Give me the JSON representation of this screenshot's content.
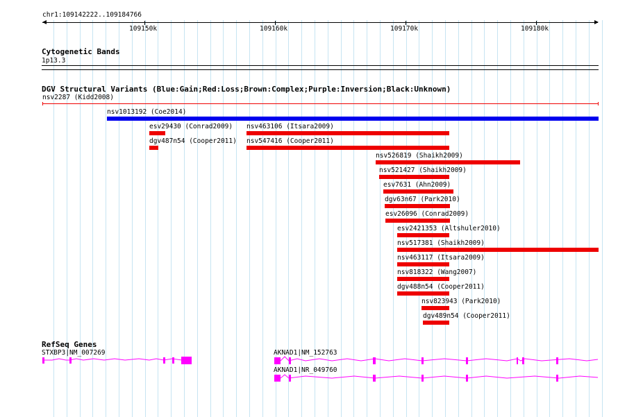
{
  "ruler": {
    "coordinates": "chr1:109142222..109184766",
    "ticks": [
      "109150k",
      "109160k",
      "109170k",
      "109180k"
    ]
  },
  "cytoband": {
    "title": "Cytogenetic Bands",
    "band": "1p13.3"
  },
  "dgv": {
    "title": "DGV Structural Variants (Blue:Gain;Red:Loss;Brown:Complex;Purple:Inversion;Black:Unknown)",
    "colors": {
      "gain": "#0000ee",
      "loss": "#ee0000"
    },
    "variants": [
      {
        "label": "nsv2287 (Kidd2008)",
        "type": "loss"
      },
      {
        "label": "nsv1013192 (Coe2014)",
        "type": "gain"
      },
      {
        "label": "esv29430 (Conrad2009)",
        "type": "loss"
      },
      {
        "label": "nsv463106 (Itsara2009)",
        "type": "loss"
      },
      {
        "label": "dgv487n54 (Cooper2011)",
        "type": "loss"
      },
      {
        "label": "nsv547416 (Cooper2011)",
        "type": "loss"
      },
      {
        "label": "nsv526819 (Shaikh2009)",
        "type": "loss"
      },
      {
        "label": "nsv521427 (Shaikh2009)",
        "type": "loss"
      },
      {
        "label": "esv7631 (Ahn2009)",
        "type": "loss"
      },
      {
        "label": "dgv63n67 (Park2010)",
        "type": "loss"
      },
      {
        "label": "esv26096 (Conrad2009)",
        "type": "loss"
      },
      {
        "label": "esv2421353 (Altshuler2010)",
        "type": "loss"
      },
      {
        "label": "nsv517381 (Shaikh2009)",
        "type": "loss"
      },
      {
        "label": "nsv463117 (Itsara2009)",
        "type": "loss"
      },
      {
        "label": "nsv818322 (Wang2007)",
        "type": "loss"
      },
      {
        "label": "dgv488n54 (Cooper2011)",
        "type": "loss"
      },
      {
        "label": "nsv823943 (Park2010)",
        "type": "loss"
      },
      {
        "label": "dgv489n54 (Cooper2011)",
        "type": "loss"
      }
    ]
  },
  "refseq": {
    "title": "RefSeq Genes",
    "color": "#ff00ff",
    "genes": [
      {
        "label": "STXBP3|NM_007269"
      },
      {
        "label": "AKNAD1|NM_152763"
      },
      {
        "label": "AKNAD1|NR_049760"
      }
    ]
  }
}
